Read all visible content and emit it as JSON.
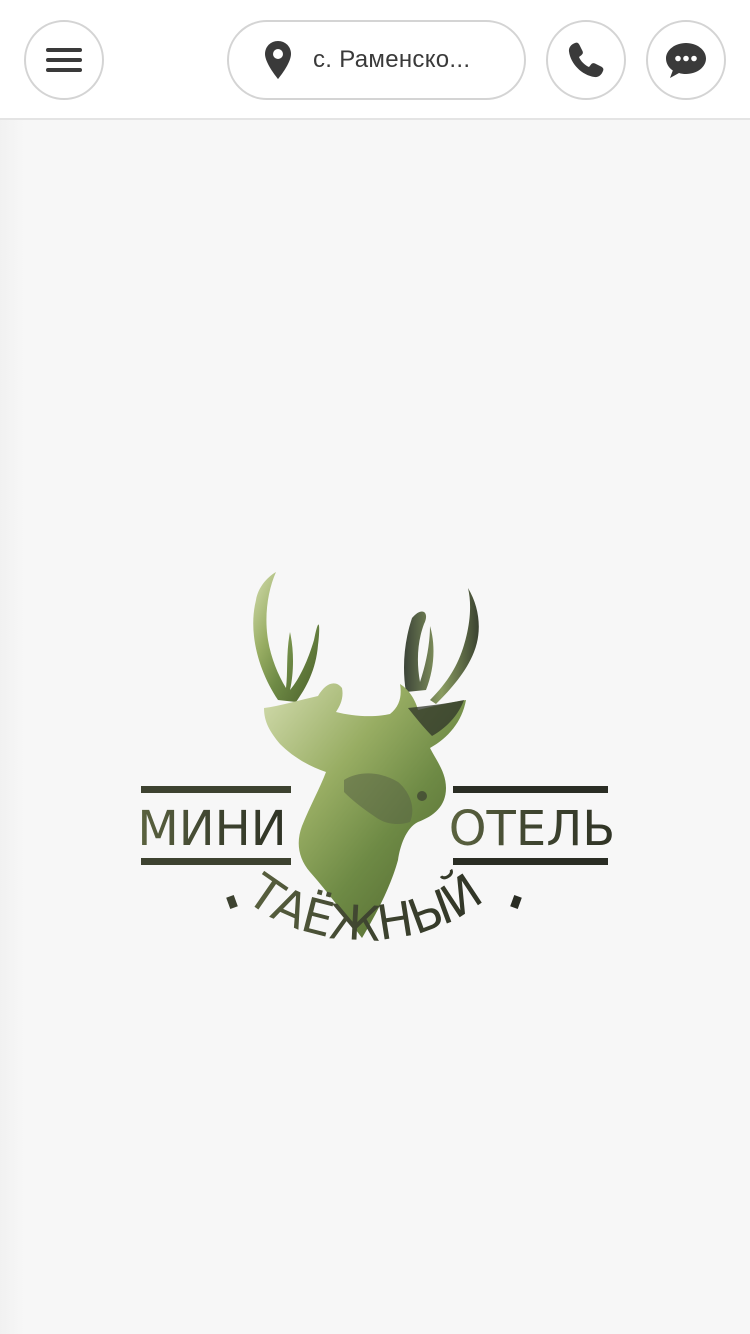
{
  "header": {
    "menu_icon": "hamburger-menu-icon",
    "location": {
      "icon": "map-pin-icon",
      "label": "с. Раменско..."
    },
    "phone_icon": "phone-icon",
    "chat_icon": "chat-bubble-icon"
  },
  "logo": {
    "word_left": "МИНИ",
    "word_right": "ОТЕЛЬ",
    "word_bottom": "ТАЁЖНЫЙ",
    "emblem": "deer-head-silhouette",
    "colors": {
      "green_light": "#c9d6a3",
      "green_mid": "#8ea35c",
      "green_dark": "#4d5e2c",
      "shadow": "#2f3328",
      "text": "#4a4e3a"
    }
  },
  "colors": {
    "background": "#f7f7f7",
    "header_bg": "#ffffff",
    "border": "#d4d4d4",
    "icon": "#3a3a3a"
  }
}
